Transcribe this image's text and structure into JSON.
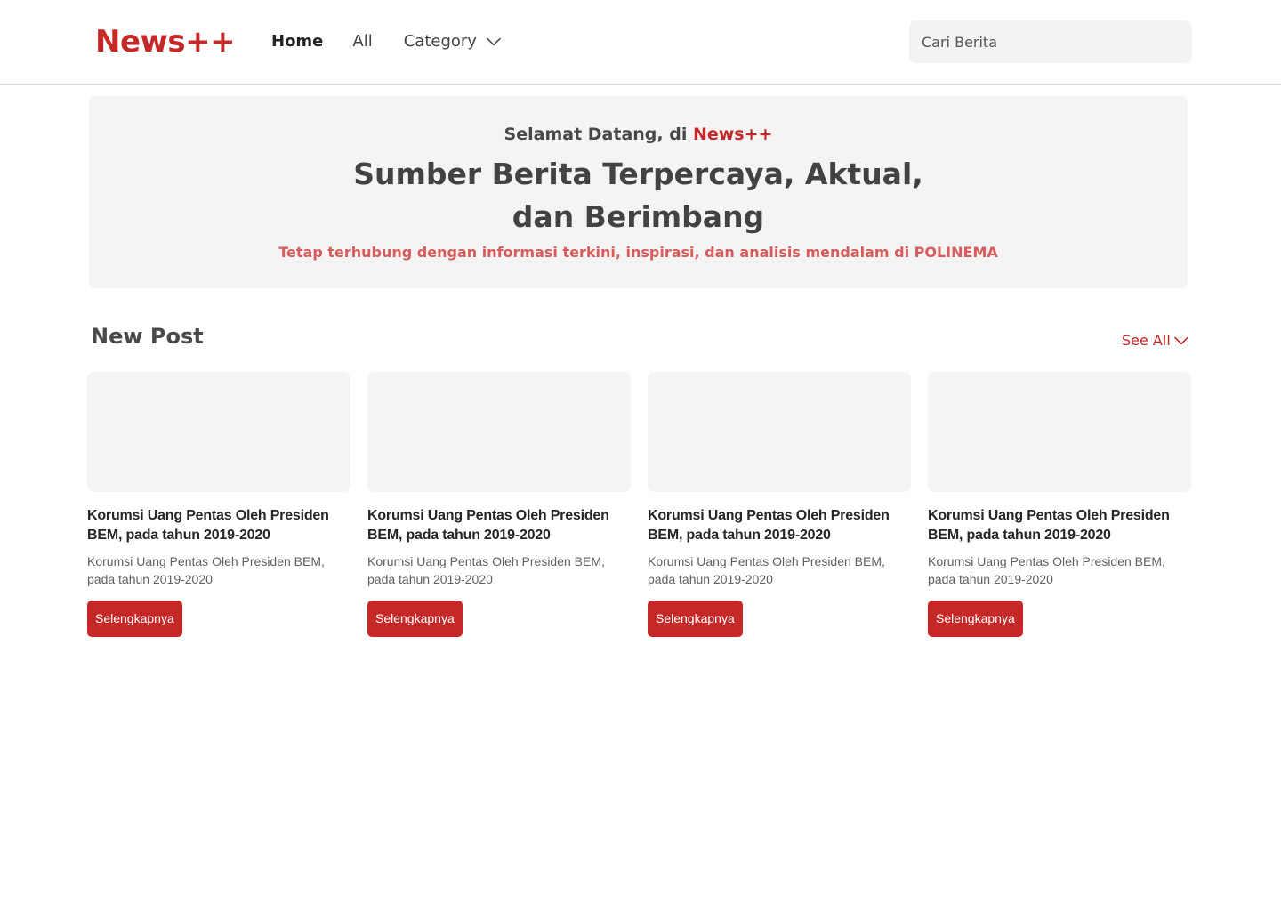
{
  "brand": {
    "logo_text": "News++",
    "color": "#c62828"
  },
  "nav": {
    "home": "Home",
    "all": "All",
    "category": "Category",
    "category_icon": "chevron-down-icon"
  },
  "search": {
    "placeholder": "Cari Berita",
    "value": ""
  },
  "hero": {
    "welcome_prefix": "Selamat Datang, di ",
    "welcome_brand": "News++",
    "title": "Sumber Berita Terpercaya, Aktual, dan Berimbang",
    "subtitle": "Tetap terhubung dengan informasi terkini, inspirasi, dan analisis mendalam di POLINEMA"
  },
  "section": {
    "title": "New Post",
    "see_all": "See All",
    "see_all_icon": "chevron-down-icon"
  },
  "posts": [
    {
      "title": "Korumsi Uang Pentas Oleh Presiden BEM, pada tahun 2019-2020",
      "description": "Korumsi Uang Pentas Oleh Presiden BEM, pada tahun 2019-2020",
      "button": "Selengkapnya"
    },
    {
      "title": "Korumsi Uang Pentas Oleh Presiden BEM, pada tahun 2019-2020",
      "description": "Korumsi Uang Pentas Oleh Presiden BEM, pada tahun 2019-2020",
      "button": "Selengkapnya"
    },
    {
      "title": "Korumsi Uang Pentas Oleh Presiden BEM, pada tahun 2019-2020",
      "description": "Korumsi Uang Pentas Oleh Presiden BEM, pada tahun 2019-2020",
      "button": "Selengkapnya"
    },
    {
      "title": "Korumsi Uang Pentas Oleh Presiden BEM, pada tahun 2019-2020",
      "description": "Korumsi Uang Pentas Oleh Presiden BEM, pada tahun 2019-2020",
      "button": "Selengkapnya"
    }
  ],
  "colors": {
    "accent": "#c62828",
    "subtitle": "#d95c5c",
    "panel": "#f4f4f4"
  }
}
